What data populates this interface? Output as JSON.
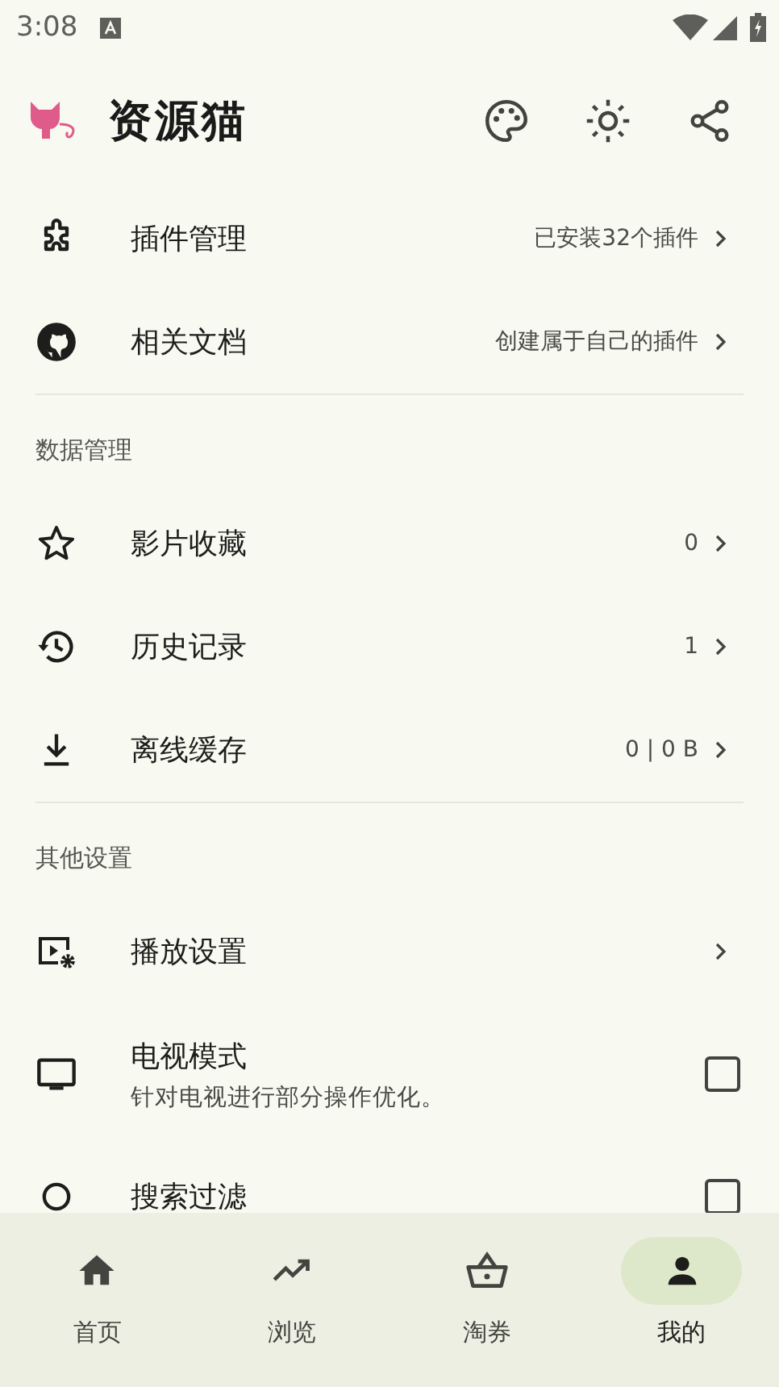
{
  "status_bar": {
    "time": "3:08"
  },
  "header": {
    "title": "资源猫"
  },
  "sections": [
    {
      "rows": [
        {
          "kind": "link",
          "label": "插件管理",
          "value": "已安装32个插件"
        },
        {
          "kind": "link",
          "label": "相关文档",
          "value": "创建属于自己的插件"
        }
      ]
    },
    {
      "title": "数据管理",
      "rows": [
        {
          "kind": "link",
          "label": "影片收藏",
          "value": "0"
        },
        {
          "kind": "link",
          "label": "历史记录",
          "value": "1"
        },
        {
          "kind": "link",
          "label": "离线缓存",
          "value": "0 | 0 B"
        }
      ]
    },
    {
      "title": "其他设置",
      "rows": [
        {
          "kind": "link",
          "label": "播放设置"
        },
        {
          "kind": "toggle",
          "label": "电视模式",
          "description": "针对电视进行部分操作优化。",
          "checked": false
        },
        {
          "kind": "toggle",
          "label": "搜索过滤",
          "checked": false
        }
      ]
    }
  ],
  "bottom_nav": [
    {
      "label": "首页",
      "selected": false
    },
    {
      "label": "浏览",
      "selected": false
    },
    {
      "label": "淘券",
      "selected": false
    },
    {
      "label": "我的",
      "selected": true
    }
  ]
}
